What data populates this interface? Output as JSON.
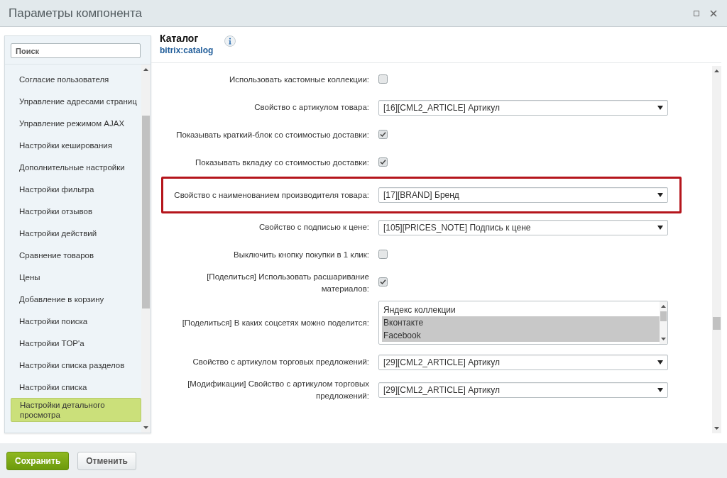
{
  "window": {
    "title": "Параметры компонента"
  },
  "sidebar": {
    "search": {
      "placeholder": "Поиск"
    },
    "items": [
      {
        "label": "Согласие пользователя",
        "selected": false
      },
      {
        "label": "Управление адресами страниц",
        "selected": false
      },
      {
        "label": "Управление режимом AJAX",
        "selected": false
      },
      {
        "label": "Настройки кеширования",
        "selected": false
      },
      {
        "label": "Дополнительные настройки",
        "selected": false
      },
      {
        "label": "Настройки фильтра",
        "selected": false
      },
      {
        "label": "Настройки отзывов",
        "selected": false
      },
      {
        "label": "Настройки действий",
        "selected": false
      },
      {
        "label": "Сравнение товаров",
        "selected": false
      },
      {
        "label": "Цены",
        "selected": false
      },
      {
        "label": "Добавление в корзину",
        "selected": false
      },
      {
        "label": "Настройки поиска",
        "selected": false
      },
      {
        "label": "Настройки TOP'a",
        "selected": false
      },
      {
        "label": "Настройки списка разделов",
        "selected": false
      },
      {
        "label": "Настройки списка",
        "selected": false
      },
      {
        "label": "Настройки детального просмотра",
        "selected": true
      }
    ]
  },
  "component": {
    "title": "Каталог",
    "code": "bitrix:catalog"
  },
  "settings": [
    {
      "kind": "checkbox",
      "label": "Использовать кастомные коллекции:",
      "checked": false,
      "highlighted": false
    },
    {
      "kind": "select",
      "label": "Свойство с артикулом товара:",
      "value": "[16][CML2_ARTICLE] Артикул",
      "highlighted": false
    },
    {
      "kind": "checkbox",
      "label": "Показывать краткий-блок со стоимостью доставки:",
      "checked": true,
      "highlighted": false
    },
    {
      "kind": "checkbox",
      "label": "Показывать вкладку со стоимостью доставки:",
      "checked": true,
      "highlighted": false
    },
    {
      "kind": "select",
      "label": "Свойство с наименованием производителя товара:",
      "value": "[17][BRAND] Бренд",
      "highlighted": true
    },
    {
      "kind": "select",
      "label": "Свойство с подписью к цене:",
      "value": "[105][PRICES_NOTE] Подпись к цене",
      "highlighted": false
    },
    {
      "kind": "checkbox",
      "label": "Выключить кнопку покупки в 1 клик:",
      "checked": false,
      "highlighted": false
    },
    {
      "kind": "checkbox",
      "label": "[Поделиться] Использовать расшаривание материалов:",
      "checked": true,
      "highlighted": false
    },
    {
      "kind": "listbox",
      "label": "[Поделиться] В каких соцсетях можно поделится:",
      "highlighted": false,
      "options": [
        {
          "label": "Яндекс коллекции",
          "selected": false
        },
        {
          "label": "Вконтакте",
          "selected": true
        },
        {
          "label": "Facebook",
          "selected": true
        }
      ]
    },
    {
      "kind": "select",
      "label": "Свойство с артикулом торговых предложений:",
      "value": "[29][CML2_ARTICLE] Артикул",
      "highlighted": false
    },
    {
      "kind": "select",
      "label": "[Модификации] Свойство с артикулом торговых предложений:",
      "value": "[29][CML2_ARTICLE] Артикул",
      "highlighted": false
    }
  ],
  "buttons": [
    {
      "label": "Сохранить",
      "kind": "primary"
    },
    {
      "label": "Отменить",
      "kind": "secondary"
    }
  ]
}
